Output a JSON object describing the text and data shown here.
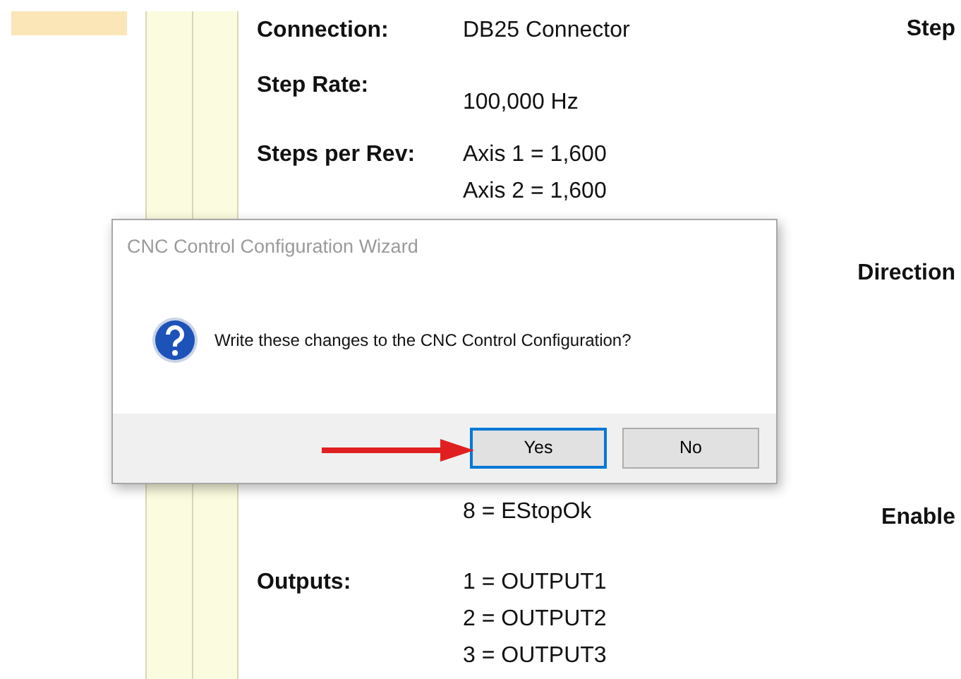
{
  "sections": [
    {
      "label": "Connection:",
      "values": [
        "DB25 Connector"
      ]
    },
    {
      "label": "Step Rate:",
      "values": [
        "100,000 Hz"
      ]
    },
    {
      "label": "Steps per Rev:",
      "values": [
        "Axis 1 = 1,600",
        "Axis 2 = 1,600"
      ]
    },
    {
      "values": [
        "8 = EStopOk"
      ]
    },
    {
      "label": "Outputs:",
      "values": [
        "1 = OUTPUT1",
        "2 = OUTPUT2",
        "3 = OUTPUT3"
      ]
    }
  ],
  "right_labels": [
    "Step",
    "Direction",
    "Enable"
  ],
  "dialog": {
    "title": "CNC Control Configuration Wizard",
    "message": "Write these changes to the CNC Control Configuration?",
    "buttons": [
      {
        "label": "Yes",
        "selected": true
      },
      {
        "label": "No",
        "selected": false
      }
    ]
  }
}
